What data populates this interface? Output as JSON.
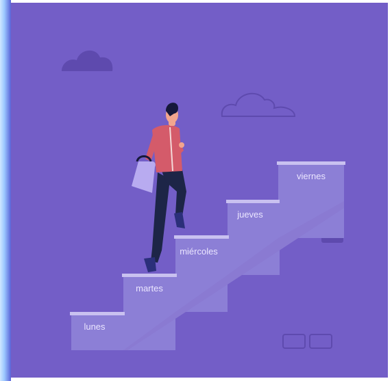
{
  "scene": {
    "colors": {
      "background": "#735ec7",
      "stairs_front": "#8c7fd6",
      "stairs_side": "#8a7ad2",
      "stairs_top": "#c9c1f0",
      "cloud_filled": "#5e4aae",
      "cloud_outline": "#5e4aae",
      "shirt": "#d45b6a",
      "pants": "#1d2547",
      "bag": "#b8abf0",
      "skin": "#f2a58e",
      "hair": "#16183a",
      "shoes": "#2b2f7a"
    },
    "steps": [
      {
        "label": "lunes"
      },
      {
        "label": "martes"
      },
      {
        "label": "miércoles"
      },
      {
        "label": "jueves"
      },
      {
        "label": "viernes"
      }
    ],
    "icons": {
      "cloud_solid": "cloud-icon",
      "cloud_outline": "cloud-outline-icon",
      "person": "person-climbing-icon",
      "briefcase": "briefcase-icon"
    }
  }
}
